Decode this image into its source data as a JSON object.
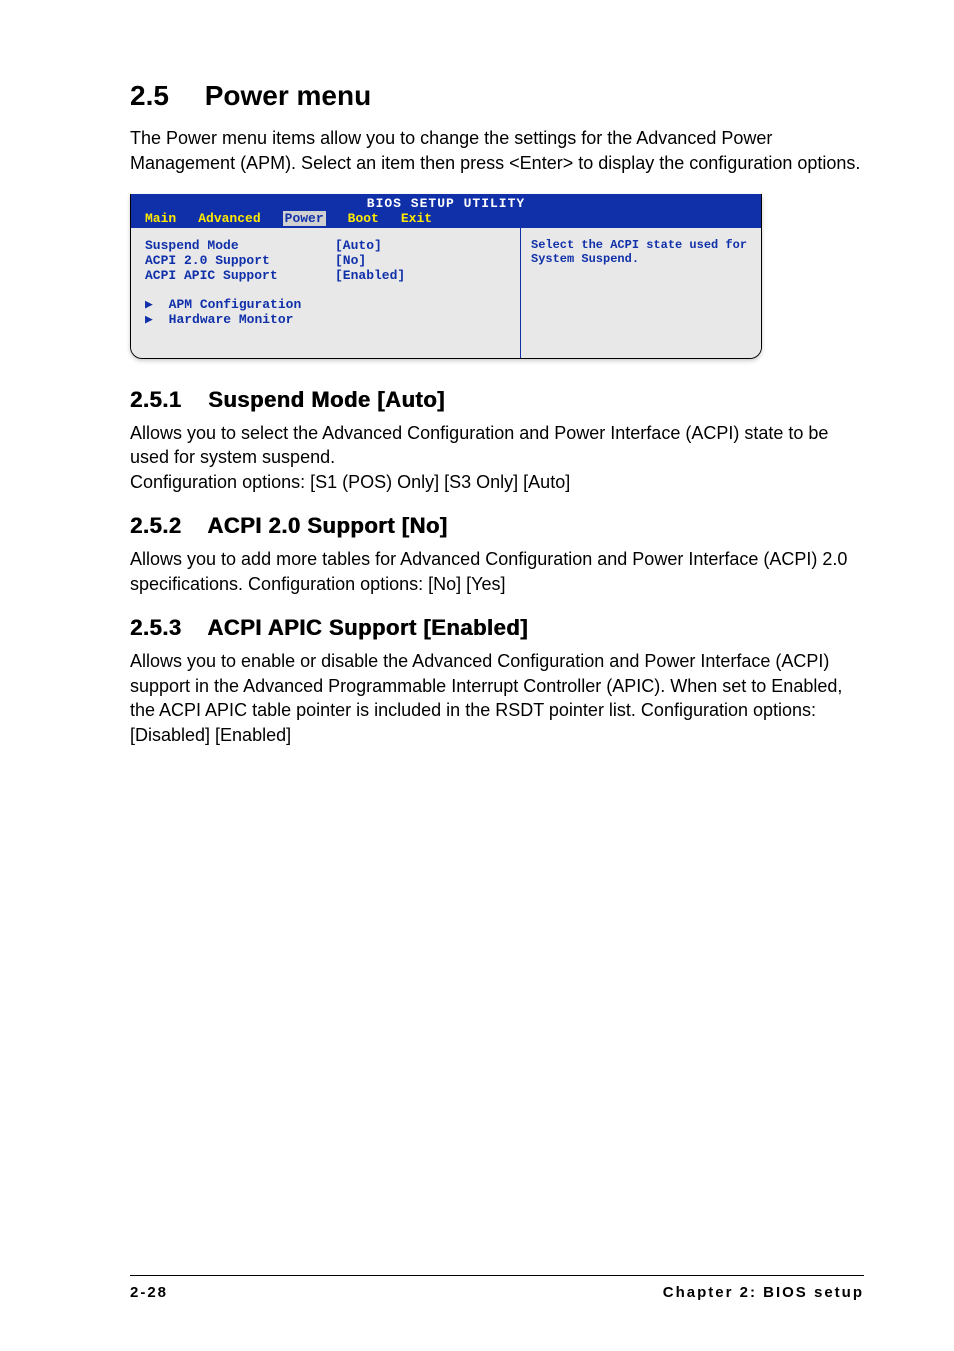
{
  "section": {
    "number": "2.5",
    "title": "Power menu",
    "intro": "The Power menu items allow you to change the settings for the Advanced Power Management (APM). Select an item then press <Enter> to display the configuration options."
  },
  "bios": {
    "title": "BIOS SETUP UTILITY",
    "tabs": [
      "Main",
      "Advanced",
      "Power",
      "Boot",
      "Exit"
    ],
    "active_tab": "Power",
    "items": [
      {
        "label": "Suspend Mode",
        "value": "[Auto]"
      },
      {
        "label": "ACPI 2.0 Support",
        "value": "[No]"
      },
      {
        "label": "ACPI APIC Support",
        "value": "[Enabled]"
      }
    ],
    "submenus": [
      "APM Configuration",
      "Hardware Monitor"
    ],
    "help": "Select the ACPI state used for System Suspend."
  },
  "sub1": {
    "number": "2.5.1",
    "title": "Suspend Mode [Auto]",
    "p1": "Allows you to select the Advanced Configuration and Power Interface (ACPI) state to be used for system suspend.",
    "p2": "Configuration options: [S1 (POS) Only] [S3 Only] [Auto]"
  },
  "sub2": {
    "number": "2.5.2",
    "title": "ACPI 2.0 Support [No]",
    "p1": "Allows you to add more tables for Advanced Configuration and Power Interface (ACPI) 2.0 specifications. Configuration options: [No] [Yes]"
  },
  "sub3": {
    "number": "2.5.3",
    "title": "ACPI APIC Support [Enabled]",
    "p1": "Allows you to enable or disable the Advanced Configuration and Power Interface (ACPI) support in the Advanced Programmable Interrupt Controller (APIC). When set to Enabled, the ACPI APIC table pointer is included in the RSDT pointer list. Configuration options: [Disabled] [Enabled]"
  },
  "footer": {
    "page": "2-28",
    "chapter": "Chapter 2: BIOS setup"
  }
}
